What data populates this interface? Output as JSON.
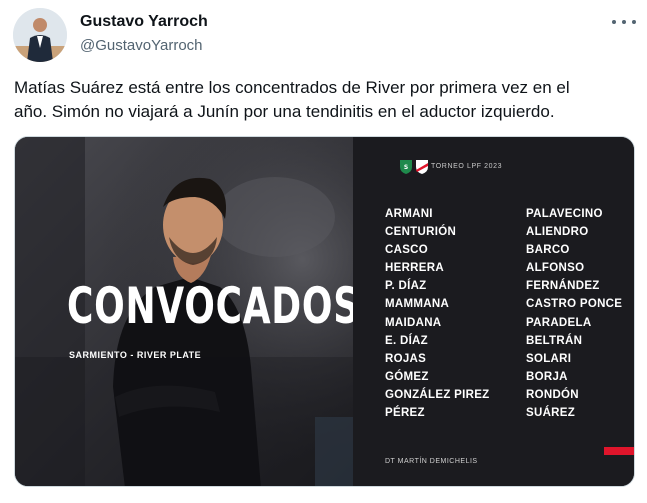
{
  "author": {
    "name": "Gustavo Yarroch",
    "handle": "@GustavoYarroch"
  },
  "tweet_text": "Matías Suárez está entre los concentrados de River por primera vez en el\naño. Simón no viajará a Junín por una tendinitis en el aductor izquierdo.",
  "graphic": {
    "headline": "CONVOCADOS",
    "match": "SARMIENTO - RIVER PLATE",
    "tournament": "TORNEO LPF 2023",
    "players_left": [
      "ARMANI",
      "CENTURIÓN",
      "CASCO",
      "HERRERA",
      "P. DÍAZ",
      "MAMMANA",
      "MAIDANA",
      "E. DÍAZ",
      "ROJAS",
      "GÓMEZ",
      "GONZÁLEZ PIREZ",
      "PÉREZ"
    ],
    "players_right": [
      "PALAVECINO",
      "ALIENDRO",
      "BARCO",
      "ALFONSO",
      "FERNÁNDEZ",
      "CASTRO PONCE",
      "PARADELA",
      "BELTRÁN",
      "SOLARI",
      "BORJA",
      "RONDÓN",
      "SUÁREZ"
    ],
    "coach": "DT MARTÍN DEMICHELIS",
    "accent_color": "#e0152b",
    "panel_color": "#1b1b1f"
  },
  "icons": {
    "more": "more-options-icon",
    "sarmiento_crest": "sarmiento-crest-icon",
    "river_crest": "river-plate-crest-icon"
  }
}
